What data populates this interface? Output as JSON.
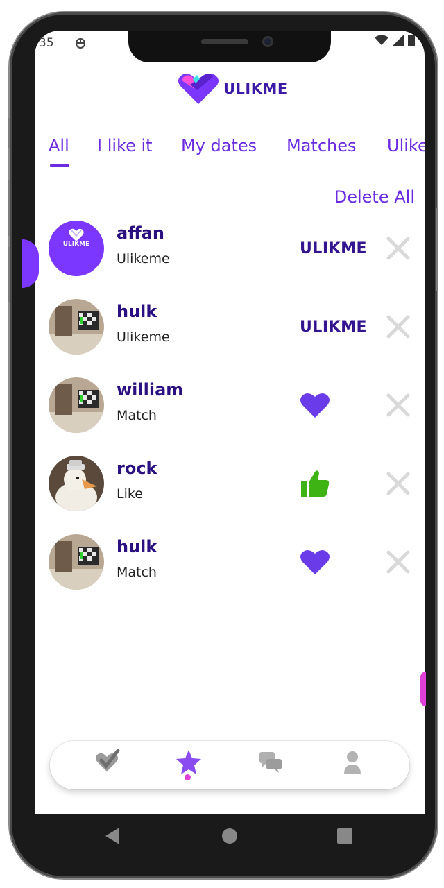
{
  "status_bar": {
    "time": "35",
    "icon": "ADB-icon"
  },
  "app": {
    "brand": "ULIKME"
  },
  "tabs": [
    {
      "label": "All",
      "active": true
    },
    {
      "label": "I like it",
      "active": false
    },
    {
      "label": "My dates",
      "active": false
    },
    {
      "label": "Matches",
      "active": false
    },
    {
      "label": "Ulike",
      "active": false
    }
  ],
  "actions": {
    "delete_all": "Delete All"
  },
  "list": [
    {
      "name": "affan",
      "status": "Ulikeme",
      "action_icon": "ulikme-wordmark",
      "action_label": "ULIKME",
      "avatar": "ulikme-logo-avatar"
    },
    {
      "name": "hulk",
      "status": "Ulikeme",
      "action_icon": "ulikme-wordmark",
      "action_label": "ULIKME",
      "avatar": "photo-avatar"
    },
    {
      "name": "william",
      "status": "Match",
      "action_icon": "heart-icon",
      "avatar": "photo-avatar"
    },
    {
      "name": "rock",
      "status": "Like",
      "action_icon": "thumbs-up-icon",
      "avatar": "duck-avatar"
    },
    {
      "name": "hulk",
      "status": "Match",
      "action_icon": "heart-icon",
      "avatar": "photo-avatar"
    }
  ],
  "avatar_badge": "ULIKME",
  "bottom_nav": [
    {
      "name": "heart-check-icon",
      "active": false
    },
    {
      "name": "star-icon",
      "active": true
    },
    {
      "name": "chat-icon",
      "active": false
    },
    {
      "name": "profile-icon",
      "active": false
    }
  ],
  "colors": {
    "accent": "#6b2be0",
    "dark": "#2a1080",
    "like_green": "#3db314",
    "pink": "#e040d8",
    "close_gray": "#d9d9d9"
  }
}
